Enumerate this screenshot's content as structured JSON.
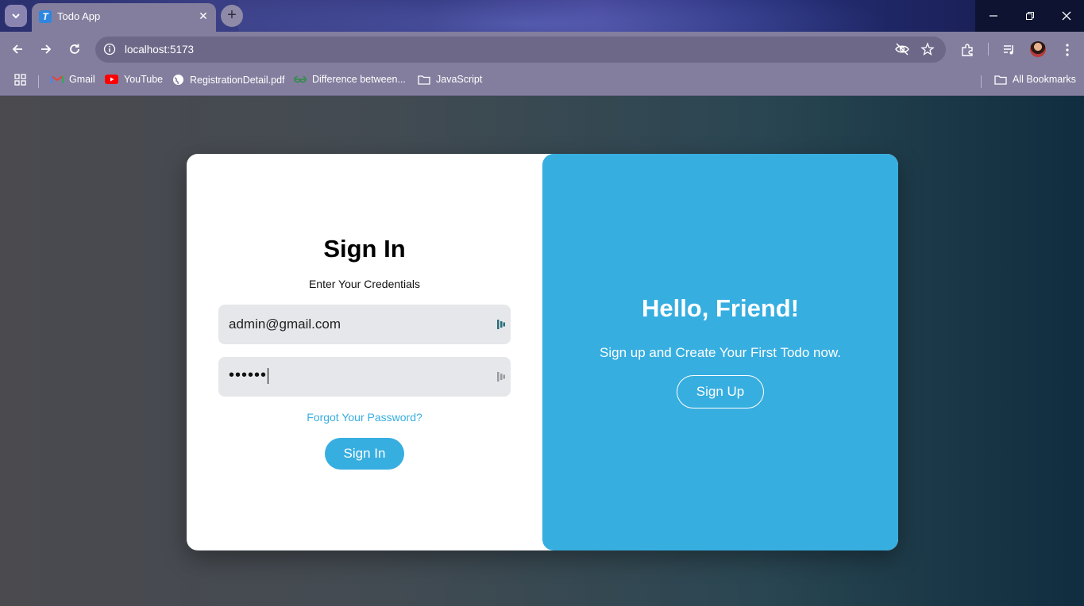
{
  "browser": {
    "tab_title": "Todo App",
    "tab_favicon_letter": "T",
    "url": "localhost:5173",
    "bookmarks": [
      {
        "label": "Gmail"
      },
      {
        "label": "YouTube"
      },
      {
        "label": "RegistrationDetail.pdf"
      },
      {
        "label": "Difference between..."
      },
      {
        "label": "JavaScript"
      }
    ],
    "all_bookmarks_label": "All Bookmarks"
  },
  "signin": {
    "title": "Sign In",
    "subtitle": "Enter Your Credentials",
    "email_value": "admin@gmail.com",
    "password_masked": "••••••",
    "forgot_label": "Forgot Your Password?",
    "button_label": "Sign In"
  },
  "signup_panel": {
    "title": "Hello, Friend!",
    "subtitle": "Sign up and Create Your First Todo now.",
    "button_label": "Sign Up"
  },
  "colors": {
    "accent": "#37aee0",
    "field_bg": "#e6e7ea"
  }
}
